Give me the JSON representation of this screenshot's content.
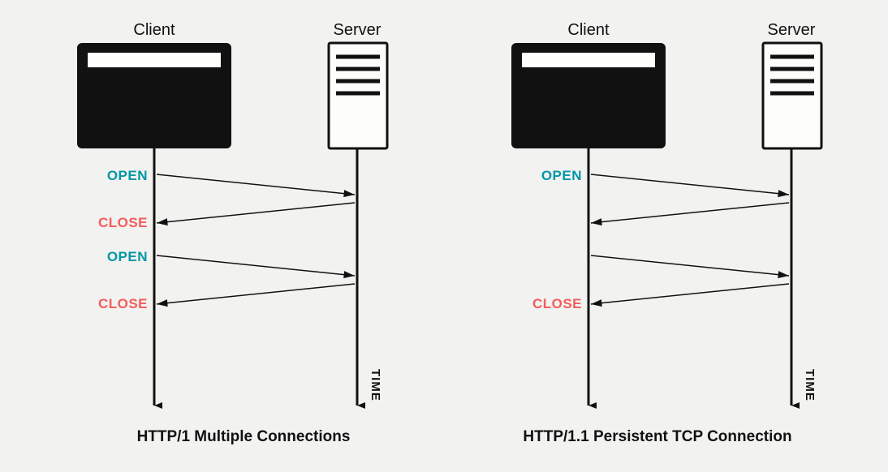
{
  "left": {
    "client_label": "Client",
    "server_label": "Server",
    "time_label": "TIME",
    "caption": "HTTP/1 Multiple Connections",
    "events": {
      "open1": "OPEN",
      "close1": "CLOSE",
      "open2": "OPEN",
      "close2": "CLOSE"
    }
  },
  "right": {
    "client_label": "Client",
    "server_label": "Server",
    "time_label": "TIME",
    "caption": "HTTP/1.1 Persistent TCP Connection",
    "events": {
      "open1": "OPEN",
      "close1": "CLOSE"
    }
  }
}
